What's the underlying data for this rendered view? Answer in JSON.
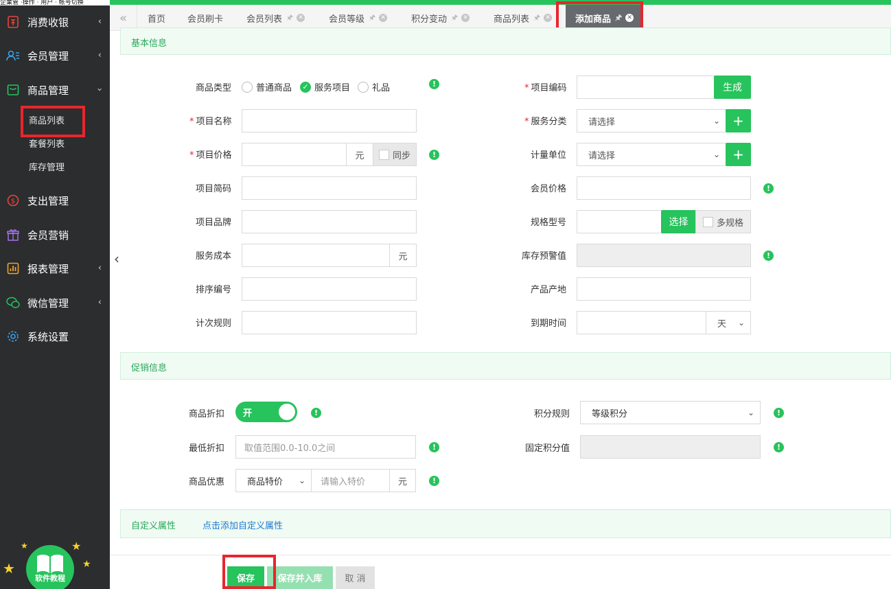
{
  "top_left_text": "企業管 ·操作 · 用户 · 帐号切换",
  "sidebar": {
    "items": [
      {
        "label": "消费收银",
        "icon": "cashier-icon",
        "has_arrow": true
      },
      {
        "label": "会员管理",
        "icon": "member-icon",
        "has_arrow": true
      },
      {
        "label": "商品管理",
        "icon": "goods-icon",
        "has_arrow": true,
        "expanded": true
      },
      {
        "label": "支出管理",
        "icon": "expense-icon",
        "has_arrow": false
      },
      {
        "label": "会员营销",
        "icon": "gift-icon",
        "has_arrow": false
      },
      {
        "label": "报表管理",
        "icon": "report-icon",
        "has_arrow": true
      },
      {
        "label": "微信管理",
        "icon": "wechat-icon",
        "has_arrow": true
      },
      {
        "label": "系统设置",
        "icon": "settings-icon",
        "has_arrow": false
      }
    ],
    "subitems": [
      "商品列表",
      "套餐列表",
      "库存管理"
    ],
    "tutorial_label": "软件教程"
  },
  "tabs": [
    {
      "label": "首页"
    },
    {
      "label": "会员刷卡"
    },
    {
      "label": "会员列表"
    },
    {
      "label": "会员等级"
    },
    {
      "label": "积分变动"
    },
    {
      "label": "商品列表"
    },
    {
      "label": "添加商品",
      "active": true
    }
  ],
  "sections": {
    "basic": "基本信息",
    "promo": "促销信息",
    "custom": "自定义属性",
    "custom_link": "点击添加自定义属性"
  },
  "basic_left": {
    "type_label": "商品类型",
    "type_options": [
      "普通商品",
      "服务项目",
      "礼品"
    ],
    "type_selected": "服务项目",
    "name_label": "项目名称",
    "price_label": "项目价格",
    "price_unit": "元",
    "price_sync": "同步",
    "abbr_label": "项目简码",
    "brand_label": "项目品牌",
    "cost_label": "服务成本",
    "cost_unit": "元",
    "sort_label": "排序编号",
    "count_label": "计次规则"
  },
  "basic_right": {
    "code_label": "项目编码",
    "code_btn": "生成",
    "category_label": "服务分类",
    "category_value": "请选择",
    "unit_label": "计量单位",
    "unit_value": "请选择",
    "member_price_label": "会员价格",
    "spec_label": "规格型号",
    "spec_btn": "选择",
    "spec_multi": "多规格",
    "stock_warn_label": "库存预警值",
    "origin_label": "产品产地",
    "expire_label": "到期时间",
    "expire_unit": "天"
  },
  "promo_left": {
    "discount_label": "商品折扣",
    "discount_toggle": "开",
    "min_discount_label": "最低折扣",
    "min_discount_placeholder": "取值范围0.0-10.0之间",
    "offer_label": "商品优惠",
    "offer_type": "商品特价",
    "offer_placeholder": "请输入特价",
    "offer_unit": "元"
  },
  "promo_right": {
    "points_label": "积分规则",
    "points_value": "等级积分",
    "fixed_points_label": "固定积分值"
  },
  "buttons": {
    "save": "保存",
    "save_stock": "保存并入库",
    "cancel": "取 消"
  },
  "colors": {
    "accent": "#27c35c",
    "sidebar_bg": "#2b2d2f",
    "highlight": "#e8262c"
  }
}
